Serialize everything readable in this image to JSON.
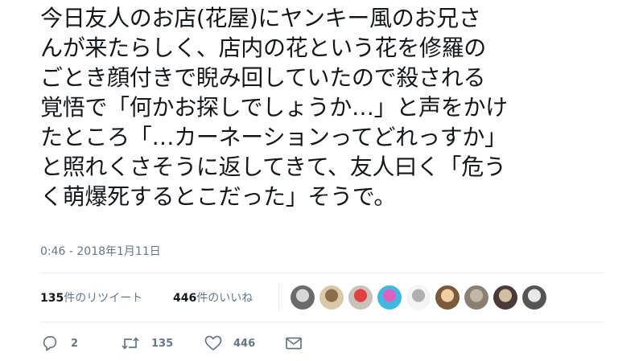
{
  "tweet": {
    "lines": [
      "今日友人のお店(花屋)にヤンキー風のお兄さ",
      "んが来たらしく、店内の花という花を修羅の",
      "ごとき顔付きで睨み回していたので殺される",
      "覚悟で「何かお探しでしょうか…」と声をかけ",
      "たところ「…カーネーションってどれっすか」",
      "と照れくさそうに返してきて、友人曰く「危う",
      "く萌爆死するとこだった」そうで。"
    ],
    "timestamp": "0:46 - 2018年1月11日"
  },
  "stats": {
    "retweets_count": "135",
    "retweets_label": "件のリツイート",
    "likes_count": "446",
    "likes_label": "件のいいね"
  },
  "avatars": [
    {
      "name": "avatar-1",
      "color": "#6b6b6b",
      "accent": "#d8d8d8"
    },
    {
      "name": "avatar-2",
      "color": "#d9c9a8",
      "accent": "#8a6d4a"
    },
    {
      "name": "avatar-3",
      "color": "#c8c2bb",
      "accent": "#e04040"
    },
    {
      "name": "avatar-4",
      "color": "#40b8e0",
      "accent": "#e060c0"
    },
    {
      "name": "avatar-5",
      "color": "#f4f4f4",
      "accent": "#b0b0b0"
    },
    {
      "name": "avatar-6",
      "color": "#7a5a3a",
      "accent": "#f0d0a0"
    },
    {
      "name": "avatar-7",
      "color": "#8a8070",
      "accent": "#c0b8a8"
    },
    {
      "name": "avatar-8",
      "color": "#4a3a3a",
      "accent": "#d0c0a0"
    },
    {
      "name": "avatar-9",
      "color": "#555555",
      "accent": "#e8e8e8"
    }
  ],
  "actions": {
    "reply_count": "2",
    "retweet_count": "135",
    "like_count": "446"
  },
  "colors": {
    "text": "#14171a",
    "muted": "#657786",
    "divider": "#e6ecf0"
  },
  "icons": [
    "reply-icon",
    "retweet-icon",
    "heart-icon",
    "envelope-icon"
  ]
}
